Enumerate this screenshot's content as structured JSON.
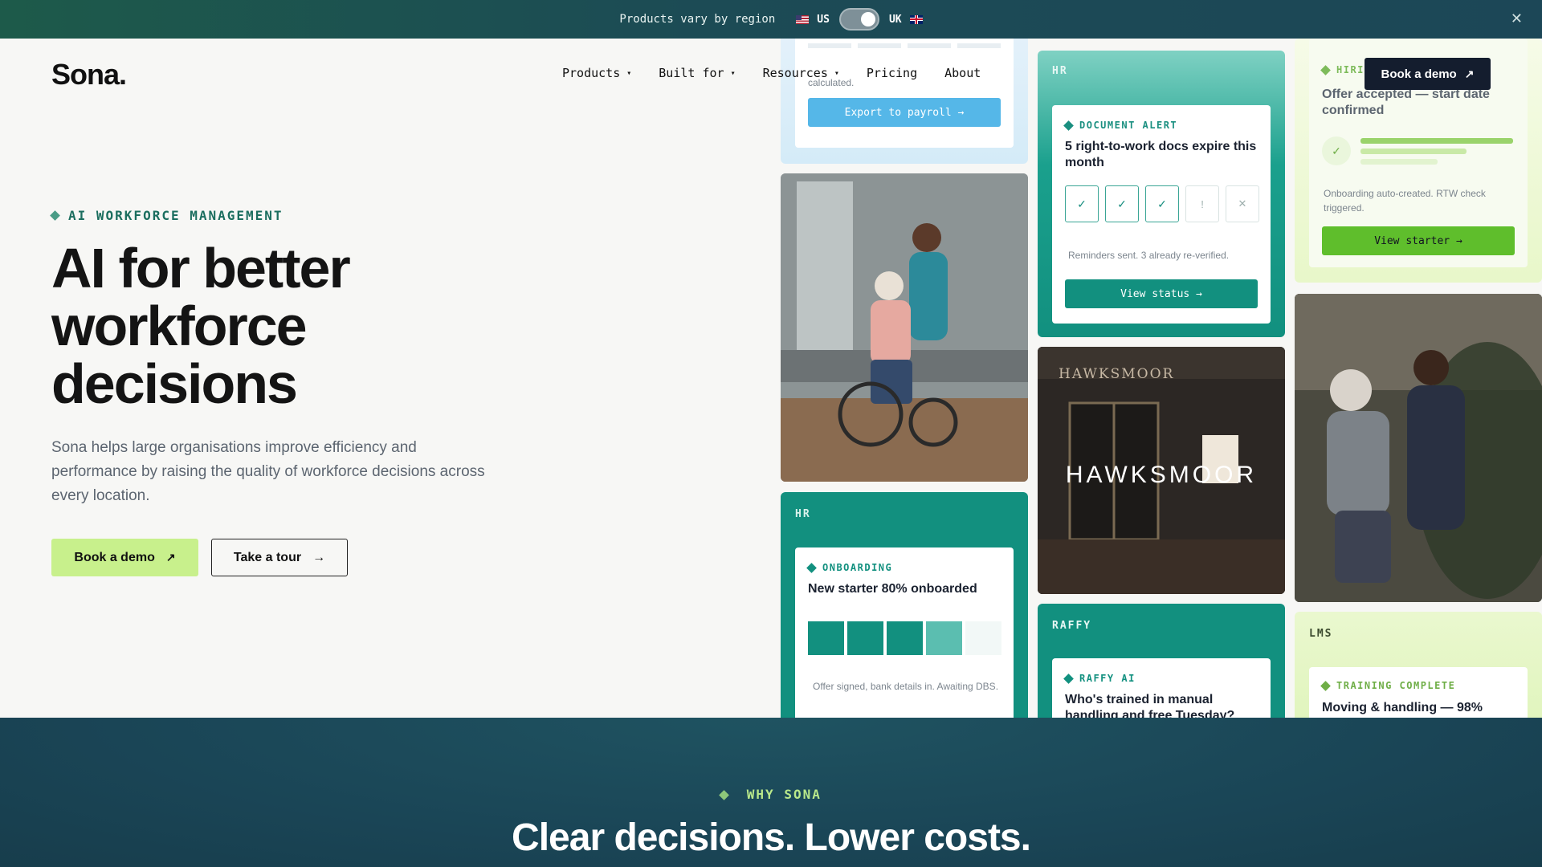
{
  "banner": {
    "region_text": "Products vary by region",
    "us_label": "US",
    "uk_label": "UK",
    "close_icon": "close-icon"
  },
  "header": {
    "logo": "Sona.",
    "nav": [
      {
        "label": "Products",
        "has_dropdown": true
      },
      {
        "label": "Built for",
        "has_dropdown": true
      },
      {
        "label": "Resources",
        "has_dropdown": true
      },
      {
        "label": "Pricing",
        "has_dropdown": false
      },
      {
        "label": "About",
        "has_dropdown": false
      }
    ],
    "book_demo": "Book a demo"
  },
  "hero": {
    "eyebrow": "AI WORKFORCE MANAGEMENT",
    "title_line1": "AI for better",
    "title_line2": "workforce",
    "title_line3": "decisions",
    "description": "Sona helps large organisations improve efficiency and performance by raising the quality of workforce decisions across every location.",
    "primary_cta": "Book a demo",
    "secondary_cta": "Take a tour"
  },
  "cards": {
    "payroll": {
      "note": "calculated.",
      "cta": "Export to payroll →"
    },
    "document_alert": {
      "tag": "HR",
      "kicker": "DOCUMENT ALERT",
      "title": "5 right-to-work docs expire this month",
      "boxes": [
        "✓",
        "✓",
        "✓",
        "!",
        "✕"
      ],
      "note": "Reminders sent. 3 already re-verified.",
      "cta": "View status →"
    },
    "hiring": {
      "kicker": "HIRI",
      "title": "Offer accepted — start date confirmed",
      "note": "Onboarding auto-created. RTW check triggered.",
      "cta": "View starter →"
    },
    "onboarding": {
      "tag": "HR",
      "kicker": "ONBOARDING",
      "title": "New starter 80% onboarded",
      "progress": 0.8,
      "note": "Offer signed, bank details in. Awaiting DBS."
    },
    "hawksmoor": {
      "sign_top": "HAWKSMOOR",
      "sign_main": "HAWKSMOOR"
    },
    "raffy": {
      "tag": "RAFFY",
      "kicker": "RAFFY AI",
      "title": "Who's trained in manual handling and free Tuesday?"
    },
    "lms": {
      "tag": "LMS",
      "kicker": "TRAINING COMPLETE",
      "title": "Moving & handling — 98%"
    }
  },
  "why": {
    "eyebrow": "WHY SONA",
    "title": "Clear decisions. Lower costs."
  },
  "colors": {
    "accent_green": "#c8f08c",
    "teal": "#12907f",
    "navy": "#141d2e",
    "light_blue": "#4fb4e6"
  }
}
